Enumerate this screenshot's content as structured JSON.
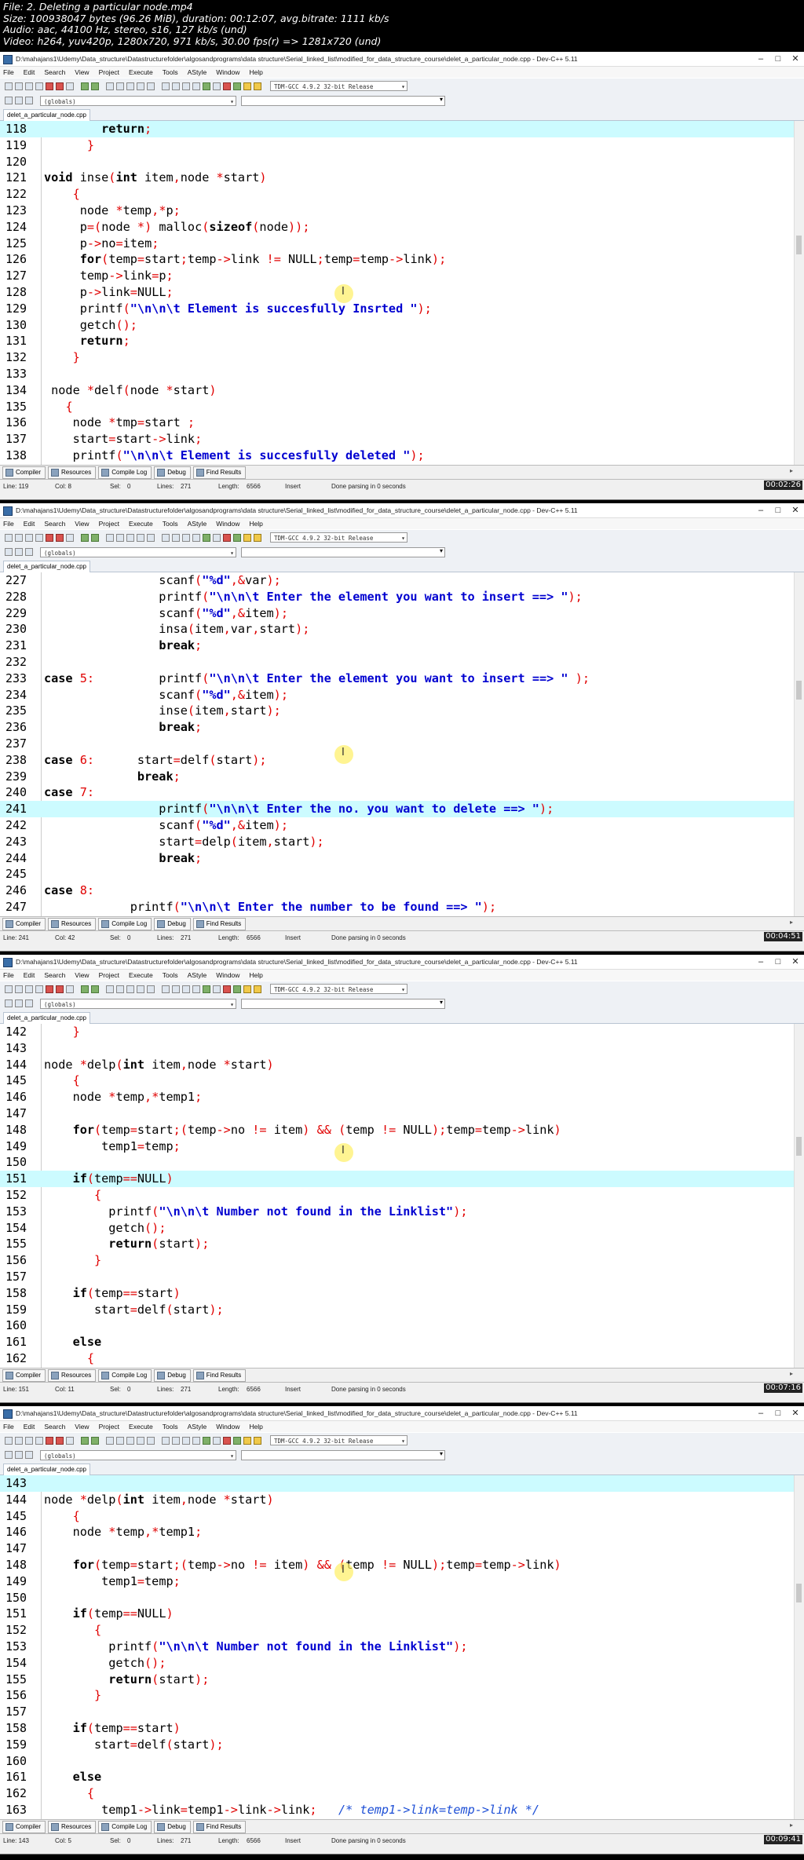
{
  "header": {
    "file": "File: 2. Deleting a particular node.mp4",
    "size": "Size: 100938047 bytes (96.26 MiB), duration: 00:12:07, avg.bitrate: 1111 kb/s",
    "audio": "Audio: aac, 44100 Hz, stereo, s16, 127 kb/s (und)",
    "video": "Video: h264, yuv420p, 1280x720, 971 kb/s, 30.00 fps(r) => 1281x720 (und)"
  },
  "window": {
    "title": "D:\\mahajans1\\Udemy\\Data_structure\\Datastructurefolder\\algosandprograms\\data structure\\Serial_linked_list\\modified_for_data_structure_course\\delet_a_particular_node.cpp - Dev-C++ 5.11",
    "menu": [
      "File",
      "Edit",
      "Search",
      "View",
      "Project",
      "Execute",
      "Tools",
      "AStyle",
      "Window",
      "Help"
    ],
    "compiler": "TDM-GCC 4.9.2 32-bit Release",
    "globals": "(globals)",
    "tab": "delet_a_particular_node.cpp",
    "bottom_tabs": [
      "Compiler",
      "Resources",
      "Compile Log",
      "Debug",
      "Find Results"
    ],
    "status_labels": {
      "sel": "Sel:",
      "lines": "Lines:",
      "length": "Length:",
      "mode": "Insert",
      "message": "Done parsing in 0 seconds"
    }
  },
  "frames": [
    {
      "timestamp": "00:02:26",
      "status": {
        "line": "Line: 119",
        "col": "Col: 8",
        "sel": "0",
        "lines": "271",
        "length": "6566"
      },
      "lines": [
        {
          "n": "118",
          "t": "        return;",
          "hl": true
        },
        {
          "n": "119",
          "t": "      }"
        },
        {
          "n": "120",
          "t": ""
        },
        {
          "n": "121",
          "t": "void inse(int item,node *start)"
        },
        {
          "n": "122",
          "t": "    {"
        },
        {
          "n": "123",
          "t": "     node *temp,*p;"
        },
        {
          "n": "124",
          "t": "     p=(node *) malloc(sizeof(node));"
        },
        {
          "n": "125",
          "t": "     p->no=item;"
        },
        {
          "n": "126",
          "t": "     for(temp=start;temp->link != NULL;temp=temp->link);"
        },
        {
          "n": "127",
          "t": "     temp->link=p;"
        },
        {
          "n": "128",
          "t": "     p->link=NULL;"
        },
        {
          "n": "129",
          "t": "     printf(\"\\n\\n\\t Element is succesfully Insrted \");"
        },
        {
          "n": "130",
          "t": "     getch();"
        },
        {
          "n": "131",
          "t": "     return;"
        },
        {
          "n": "132",
          "t": "    }"
        },
        {
          "n": "133",
          "t": ""
        },
        {
          "n": "134",
          "t": " node *delf(node *start)"
        },
        {
          "n": "135",
          "t": "   {"
        },
        {
          "n": "136",
          "t": "    node *tmp=start ;"
        },
        {
          "n": "137",
          "t": "    start=start->link;"
        },
        {
          "n": "138",
          "t": "    printf(\"\\n\\n\\t Element is succesfully deleted \");"
        }
      ]
    },
    {
      "timestamp": "00:04:51",
      "status": {
        "line": "Line: 241",
        "col": "Col: 42",
        "sel": "0",
        "lines": "271",
        "length": "6566"
      },
      "lines": [
        {
          "n": "227",
          "t": "                scanf(\"%d\",&var);"
        },
        {
          "n": "228",
          "t": "                printf(\"\\n\\n\\t Enter the element you want to insert ==> \");"
        },
        {
          "n": "229",
          "t": "                scanf(\"%d\",&item);"
        },
        {
          "n": "230",
          "t": "                insa(item,var,start);"
        },
        {
          "n": "231",
          "t": "                break;"
        },
        {
          "n": "232",
          "t": ""
        },
        {
          "n": "233",
          "t": "case 5:         printf(\"\\n\\n\\t Enter the element you want to insert ==> \" );"
        },
        {
          "n": "234",
          "t": "                scanf(\"%d\",&item);"
        },
        {
          "n": "235",
          "t": "                inse(item,start);"
        },
        {
          "n": "236",
          "t": "                break;"
        },
        {
          "n": "237",
          "t": ""
        },
        {
          "n": "238",
          "t": "case 6:      start=delf(start);"
        },
        {
          "n": "239",
          "t": "             break;"
        },
        {
          "n": "240",
          "t": "case 7:"
        },
        {
          "n": "241",
          "t": "                printf(\"\\n\\n\\t Enter the no. you want to delete ==> \");",
          "hl": true
        },
        {
          "n": "242",
          "t": "                scanf(\"%d\",&item);"
        },
        {
          "n": "243",
          "t": "                start=delp(item,start);"
        },
        {
          "n": "244",
          "t": "                break;"
        },
        {
          "n": "245",
          "t": ""
        },
        {
          "n": "246",
          "t": "case 8:"
        },
        {
          "n": "247",
          "t": "            printf(\"\\n\\n\\t Enter the number to be found ==> \");"
        }
      ]
    },
    {
      "timestamp": "00:07:16",
      "status": {
        "line": "Line: 151",
        "col": "Col: 11",
        "sel": "0",
        "lines": "271",
        "length": "6566"
      },
      "lines": [
        {
          "n": "142",
          "t": "    }"
        },
        {
          "n": "143",
          "t": ""
        },
        {
          "n": "144",
          "t": "node *delp(int item,node *start)"
        },
        {
          "n": "145",
          "t": "    {"
        },
        {
          "n": "146",
          "t": "    node *temp,*temp1;"
        },
        {
          "n": "147",
          "t": ""
        },
        {
          "n": "148",
          "t": "    for(temp=start;(temp->no != item) && (temp != NULL);temp=temp->link)"
        },
        {
          "n": "149",
          "t": "        temp1=temp;"
        },
        {
          "n": "150",
          "t": ""
        },
        {
          "n": "151",
          "t": "    if(temp==NULL)",
          "hl": true
        },
        {
          "n": "152",
          "t": "       {"
        },
        {
          "n": "153",
          "t": "         printf(\"\\n\\n\\t Number not found in the Linklist\");"
        },
        {
          "n": "154",
          "t": "         getch();"
        },
        {
          "n": "155",
          "t": "         return(start);"
        },
        {
          "n": "156",
          "t": "       }"
        },
        {
          "n": "157",
          "t": ""
        },
        {
          "n": "158",
          "t": "    if(temp==start)"
        },
        {
          "n": "159",
          "t": "       start=delf(start);"
        },
        {
          "n": "160",
          "t": ""
        },
        {
          "n": "161",
          "t": "    else"
        },
        {
          "n": "162",
          "t": "      {"
        }
      ]
    },
    {
      "timestamp": "00:09:41",
      "status": {
        "line": "Line: 143",
        "col": "Col: 5",
        "sel": "0",
        "lines": "271",
        "length": "6566"
      },
      "lines": [
        {
          "n": "143",
          "t": "",
          "hl": true
        },
        {
          "n": "144",
          "t": "node *delp(int item,node *start)"
        },
        {
          "n": "145",
          "t": "    {"
        },
        {
          "n": "146",
          "t": "    node *temp,*temp1;"
        },
        {
          "n": "147",
          "t": ""
        },
        {
          "n": "148",
          "t": "    for(temp=start;(temp->no != item) && (temp != NULL);temp=temp->link)"
        },
        {
          "n": "149",
          "t": "        temp1=temp;"
        },
        {
          "n": "150",
          "t": ""
        },
        {
          "n": "151",
          "t": "    if(temp==NULL)"
        },
        {
          "n": "152",
          "t": "       {"
        },
        {
          "n": "153",
          "t": "         printf(\"\\n\\n\\t Number not found in the Linklist\");"
        },
        {
          "n": "154",
          "t": "         getch();"
        },
        {
          "n": "155",
          "t": "         return(start);"
        },
        {
          "n": "156",
          "t": "       }"
        },
        {
          "n": "157",
          "t": ""
        },
        {
          "n": "158",
          "t": "    if(temp==start)"
        },
        {
          "n": "159",
          "t": "       start=delf(start);"
        },
        {
          "n": "160",
          "t": ""
        },
        {
          "n": "161",
          "t": "    else"
        },
        {
          "n": "162",
          "t": "      {"
        },
        {
          "n": "163",
          "t": "        temp1->link=temp1->link->link;   /* temp1->link=temp->link */"
        }
      ]
    }
  ]
}
